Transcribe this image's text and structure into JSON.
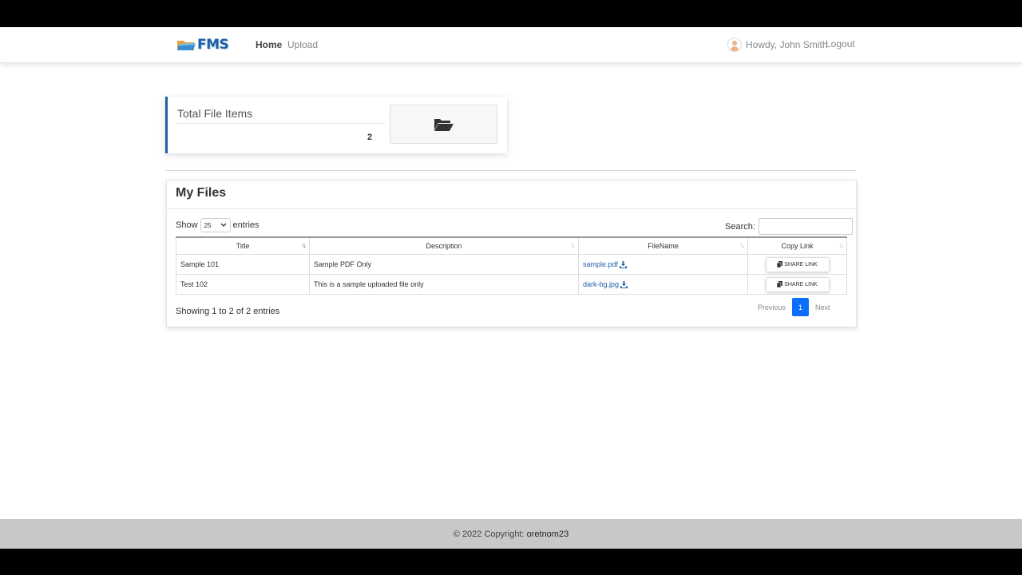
{
  "navbar": {
    "brand": "FMS",
    "links": [
      "Home",
      "Upload"
    ],
    "greeting": "Howdy, John Smith",
    "logout": "Logout"
  },
  "stat_card": {
    "title": "Total File Items",
    "value": "2",
    "icon": "folder-open-icon"
  },
  "files": {
    "title": "My Files",
    "length_prefix": "Show",
    "length_value": "25",
    "length_suffix": "entries",
    "search_label": "Search:",
    "search_value": "",
    "columns": [
      "Title",
      "Description",
      "FileName",
      "Copy Link"
    ],
    "rows": [
      {
        "title": "Sample 101",
        "description": "Sample PDF Only",
        "filename": "sample.pdf",
        "action": "SHARE LINK"
      },
      {
        "title": "Test 102",
        "description": "This is a sample uploaded file only",
        "filename": "dark-bg.jpg",
        "action": "SHARE LINK"
      }
    ],
    "info": "Showing 1 to 2 of 2 entries",
    "pagination": {
      "previous": "Previous",
      "current": "1",
      "next": "Next"
    }
  },
  "footer": {
    "text": "© 2022 Copyright:",
    "link": "oretnom23"
  },
  "colors": {
    "primary": "#1f5fa8",
    "pager_active": "#0d6efd",
    "footer_bg": "#c8c8c8"
  }
}
